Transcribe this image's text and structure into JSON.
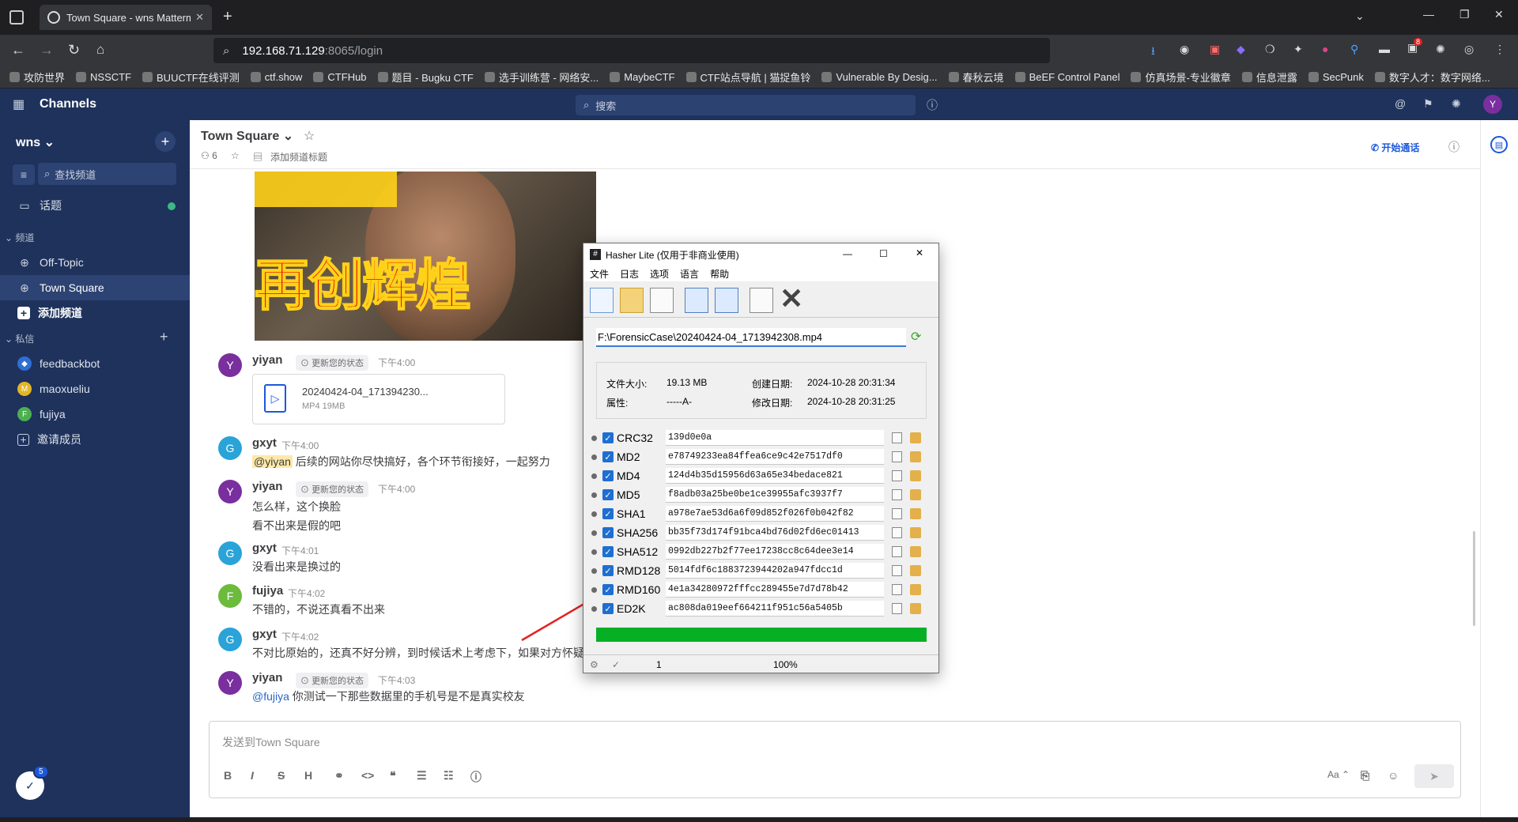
{
  "browser": {
    "tab_title": "Town Square - wns Mattermost",
    "url_host": "192.168.71.129",
    "url_rest": ":8065/login",
    "ext_badge": "8",
    "bookmarks": [
      "攻防世界",
      "NSSCTF",
      "BUUCTF在线评测",
      "ctf.show",
      "CTFHub",
      "题目 - Bugku CTF",
      "选手训练营 - 网络安...",
      "MaybeCTF",
      "CTF站点导航 | 猫捉鱼铃",
      "Vulnerable By Desig...",
      "春秋云境",
      "BeEF Control Panel",
      "仿真场景-专业徽章",
      "信息泄露",
      "SecPunk",
      "数字人才：数字网络..."
    ]
  },
  "header": {
    "product": "Channels",
    "search_placeholder": "搜索"
  },
  "sidebar": {
    "team": "wns",
    "find_channel": "查找频道",
    "threads": "话题",
    "channels_section": "频道",
    "channels": [
      "Off-Topic",
      "Town Square"
    ],
    "add_channel": "添加频道",
    "dm_section": "私信",
    "dms": [
      "feedbackbot",
      "maoxueliu",
      "fujiya"
    ],
    "invite": "邀请成员",
    "badge_count": "5"
  },
  "channel": {
    "name": "Town Square",
    "members": "6",
    "add_header": "添加频道标题",
    "start_call": "开始通话"
  },
  "meme_text": "再创辉煌",
  "messages": [
    {
      "avatar": "Y",
      "name": "yiyan",
      "status": "更新您的状态",
      "time": "下午4:00",
      "file_name": "20240424-04_171394230...",
      "file_meta": "MP4 19MB"
    },
    {
      "avatar": "G",
      "name": "gxyt",
      "time": "下午4:00",
      "mention": "@yiyan",
      "text": "后续的网站你尽快搞好，各个环节衔接好，一起努力"
    },
    {
      "avatar": "Y",
      "name": "yiyan",
      "status": "更新您的状态",
      "time": "下午4:00",
      "line1": "怎么样，这个换脸",
      "line2": "看不出来是假的吧"
    },
    {
      "avatar": "G",
      "name": "gxyt",
      "time": "下午4:01",
      "text": "没看出来是换过的"
    },
    {
      "avatar": "F",
      "name": "fujiya",
      "time": "下午4:02",
      "text": "不错的，不说还真看不出来"
    },
    {
      "avatar": "G",
      "name": "gxyt",
      "time": "下午4:02",
      "text": "不对比原始的，还真不好分辨，到时候话术上考虑下，如果对方怀疑，"
    },
    {
      "avatar": "Y",
      "name": "yiyan",
      "status": "更新您的状态",
      "time": "下午4:03",
      "mention": "@fujiya",
      "text": "你测试一下那些数据里的手机号是不是真实校友"
    }
  ],
  "composer": {
    "placeholder": "发送到Town Square",
    "aa": "Aa"
  },
  "hasher": {
    "title": "Hasher Lite  (仅用于非商业使用)",
    "menu": [
      "文件",
      "日志",
      "选项",
      "语言",
      "帮助"
    ],
    "path": "F:\\ForensicCase\\20240424-04_1713942308.mp4",
    "file_size_label": "文件大小:",
    "file_size": "19.13 MB",
    "attr_label": "属性:",
    "attr": "-----A-",
    "created_label": "创建日期:",
    "created": "2024-10-28 20:31:34",
    "modified_label": "修改日期:",
    "modified": "2024-10-28 20:31:25",
    "hashes": [
      {
        "alg": "CRC32",
        "value": "139d0e0a"
      },
      {
        "alg": "MD2",
        "value": "e78749233ea84ffea6ce9c42e7517df0"
      },
      {
        "alg": "MD4",
        "value": "124d4b35d15956d63a65e34bedace821"
      },
      {
        "alg": "MD5",
        "value": "f8adb03a25be0be1ce39955afc3937f7"
      },
      {
        "alg": "SHA1",
        "value": "a978e7ae53d6a6f09d852f026f0b042f82"
      },
      {
        "alg": "SHA256",
        "value": "bb35f73d174f91bca4bd76d02fd6ec01413"
      },
      {
        "alg": "SHA512",
        "value": "0992db227b2f77ee17238cc8c64dee3e14"
      },
      {
        "alg": "RMD128",
        "value": "5014fdf6c1883723944202a947fdcc1d"
      },
      {
        "alg": "RMD160",
        "value": "4e1a34280972fffcc289455e7d7d78b42"
      },
      {
        "alg": "ED2K",
        "value": "ac808da019eef664211f951c56a5405b"
      }
    ],
    "progress": 1.0,
    "status_count": "1",
    "status_pct": "100%"
  }
}
